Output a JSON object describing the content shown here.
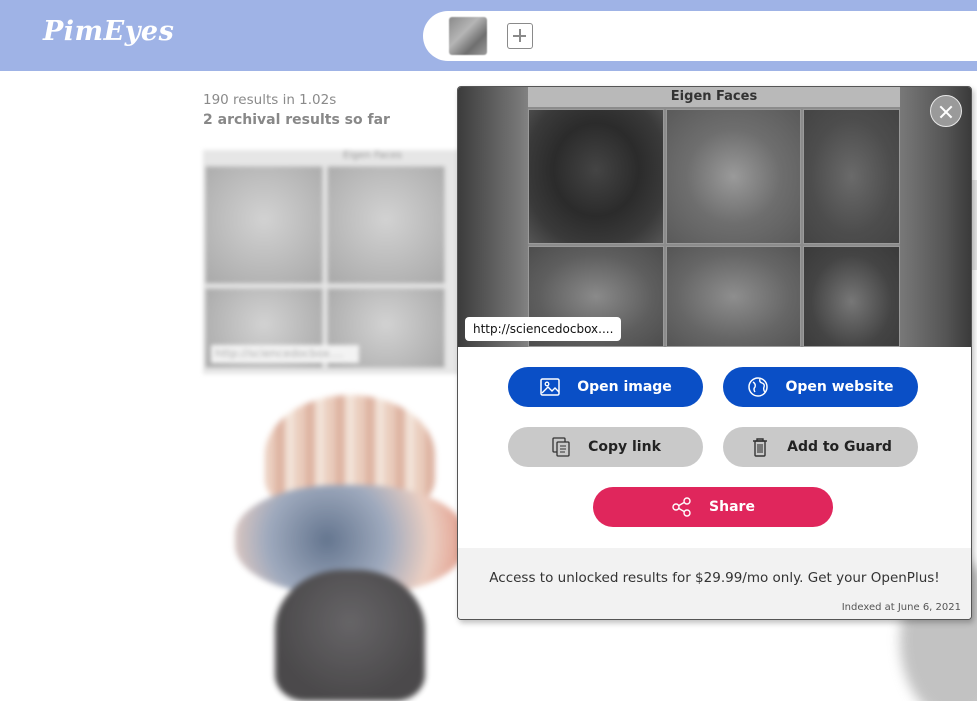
{
  "header": {
    "logo": "PimEyes"
  },
  "results": {
    "count_text": "190 results in 1.02s",
    "archival_text": "2 archival results so far",
    "card_title": "Eigen Faces",
    "card_link": "http://sciencedocbox...."
  },
  "modal": {
    "preview_title": "Eigen Faces",
    "source_link": "http://sciencedocbox....",
    "buttons": {
      "open_image": "Open image",
      "open_website": "Open website",
      "copy_link": "Copy link",
      "add_to_guard": "Add to Guard",
      "share": "Share"
    },
    "promo": "Access to unlocked results for $29.99/mo only. Get your OpenPlus!",
    "indexed": "Indexed at June 6, 2021"
  },
  "colors": {
    "header_bg": "#9fb3e6",
    "primary_blue": "#0a4fc6",
    "secondary_grey": "#c9c9c9",
    "share_pink": "#e0265c"
  },
  "icons": [
    "image-icon",
    "globe-icon",
    "copy-icon",
    "trash-icon",
    "share-icon",
    "close-icon",
    "add-photo-icon"
  ]
}
